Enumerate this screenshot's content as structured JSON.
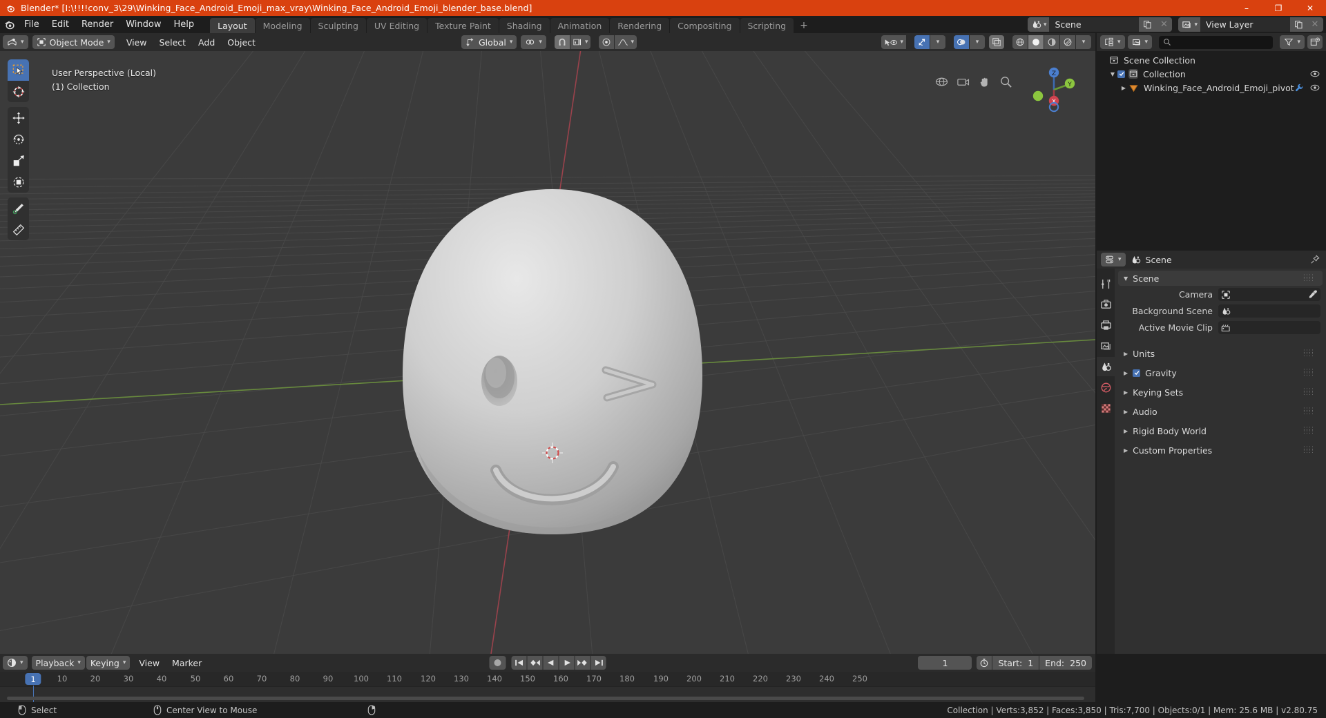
{
  "titlebar": {
    "text": "Blender* [I:\\!!!!conv_3\\29\\Winking_Face_Android_Emoji_max_vray\\Winking_Face_Android_Emoji_blender_base.blend]",
    "minimize": "–",
    "maximize": "❐",
    "close": "✕",
    "bg": "#d9410f"
  },
  "topbar": {
    "menus": [
      "File",
      "Edit",
      "Render",
      "Window",
      "Help"
    ],
    "workspaces": [
      {
        "label": "Layout",
        "active": true
      },
      {
        "label": "Modeling",
        "active": false
      },
      {
        "label": "Sculpting",
        "active": false
      },
      {
        "label": "UV Editing",
        "active": false
      },
      {
        "label": "Texture Paint",
        "active": false
      },
      {
        "label": "Shading",
        "active": false
      },
      {
        "label": "Animation",
        "active": false
      },
      {
        "label": "Rendering",
        "active": false
      },
      {
        "label": "Compositing",
        "active": false
      },
      {
        "label": "Scripting",
        "active": false
      }
    ],
    "add_workspace": "+",
    "scene_name": "Scene",
    "view_layer_name": "View Layer"
  },
  "viewport": {
    "mode": "Object Mode",
    "menus": [
      "View",
      "Select",
      "Add",
      "Object"
    ],
    "transform_orientation": "Global",
    "overlay_text_line1": "User Perspective (Local)",
    "overlay_text_line2": "(1) Collection",
    "axis_x": "X",
    "axis_y": "Y",
    "axis_z": "Z",
    "tools": [
      {
        "name": "tweak-select-box",
        "active": true
      },
      {
        "name": "cursor",
        "active": false
      },
      {
        "name": "move",
        "active": false
      },
      {
        "name": "rotate",
        "active": false
      },
      {
        "name": "scale",
        "active": false
      },
      {
        "name": "transform",
        "active": false
      },
      {
        "name": "annotate",
        "active": false
      },
      {
        "name": "measure",
        "active": false
      }
    ]
  },
  "outliner": {
    "search_placeholder": "",
    "rows": [
      {
        "label": "Scene Collection",
        "indent": 0,
        "icon": "collection-icon",
        "has_tri": false,
        "has_check": false,
        "has_eye": false
      },
      {
        "label": "Collection",
        "indent": 1,
        "icon": "collection-icon",
        "has_tri": true,
        "has_check": true,
        "has_eye": true
      },
      {
        "label": "Winking_Face_Android_Emoji_pivot",
        "indent": 2,
        "icon": "empty-icon",
        "has_tri": true,
        "has_check": false,
        "has_eye": true,
        "has_wrench": true
      }
    ]
  },
  "properties": {
    "header_title": "Scene",
    "panel_title": "Scene",
    "rows": [
      {
        "label": "Camera",
        "icon": "camera-icon",
        "value": "",
        "eyedropper": true
      },
      {
        "label": "Background Scene",
        "icon": "scene-icon",
        "value": "",
        "eyedropper": false
      },
      {
        "label": "Active Movie Clip",
        "icon": "clip-icon",
        "value": "",
        "eyedropper": false
      }
    ],
    "sections": [
      {
        "label": "Units",
        "checkbox": false
      },
      {
        "label": "Gravity",
        "checkbox": true
      },
      {
        "label": "Keying Sets",
        "checkbox": false
      },
      {
        "label": "Audio",
        "checkbox": false
      },
      {
        "label": "Rigid Body World",
        "checkbox": false
      },
      {
        "label": "Custom Properties",
        "checkbox": false
      }
    ],
    "tabs": [
      {
        "name": "tool-tab",
        "active": false
      },
      {
        "name": "render-tab",
        "active": false
      },
      {
        "name": "output-tab",
        "active": false
      },
      {
        "name": "view-layer-tab",
        "active": false
      },
      {
        "name": "scene-tab",
        "active": true
      },
      {
        "name": "world-tab",
        "active": false
      },
      {
        "name": "texture-tab",
        "active": false
      }
    ]
  },
  "timeline": {
    "menus": [
      "Playback",
      "Keying",
      "View",
      "Marker"
    ],
    "current_frame": "1",
    "start_label": "Start:",
    "start_value": "1",
    "end_label": "End:",
    "end_value": "250",
    "ticks": [
      "10",
      "20",
      "30",
      "40",
      "50",
      "60",
      "70",
      "80",
      "90",
      "100",
      "110",
      "120",
      "130",
      "140",
      "150",
      "160",
      "170",
      "180",
      "190",
      "200",
      "210",
      "220",
      "230",
      "240",
      "250"
    ],
    "tick_positions": [
      90,
      138,
      186,
      234,
      283,
      331,
      379,
      427,
      475,
      523,
      571,
      620,
      668,
      716,
      764,
      812,
      860,
      908,
      957,
      1005,
      1053,
      1101,
      1149,
      1197,
      1245
    ]
  },
  "statusbar": {
    "left_items": [
      {
        "icon": "mouse-left-icon",
        "label": "Select"
      },
      {
        "icon": "mouse-middle-icon",
        "label": "Center View to Mouse"
      },
      {
        "icon": "mouse-right-icon",
        "label": ""
      }
    ],
    "stats": "Collection | Verts:3,852 | Faces:3,850 | Tris:7,700 | Objects:0/1 | Mem: 25.6 MB | v2.80.75"
  },
  "colors": {
    "accent_blue": "#4772b3",
    "brand_orange": "#d9410f",
    "viewport_bg": "#3b3b3b",
    "axis_x": "#c5424e",
    "axis_y": "#7fae3f"
  }
}
